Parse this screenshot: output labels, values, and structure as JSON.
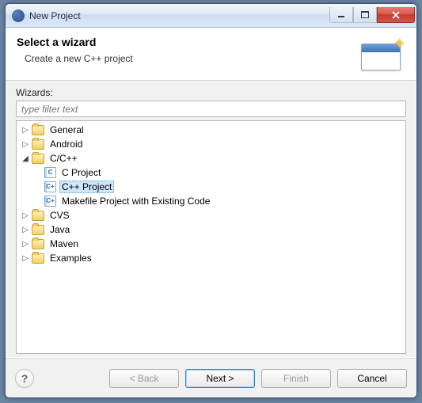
{
  "window": {
    "title": "New Project"
  },
  "banner": {
    "heading": "Select a wizard",
    "subtext": "Create a new C++ project"
  },
  "wizards": {
    "label": "Wizards:",
    "filter_placeholder": "type filter text"
  },
  "tree": {
    "general": "General",
    "android": "Android",
    "ccpp": "C/C++",
    "c_project": "C Project",
    "cpp_project": "C++ Project",
    "makefile_project": "Makefile Project with Existing Code",
    "cvs": "CVS",
    "java": "Java",
    "maven": "Maven",
    "examples": "Examples",
    "c_badge": "C",
    "cpp_badge": "C+"
  },
  "buttons": {
    "help": "?",
    "back": "< Back",
    "next": "Next >",
    "finish": "Finish",
    "cancel": "Cancel"
  }
}
